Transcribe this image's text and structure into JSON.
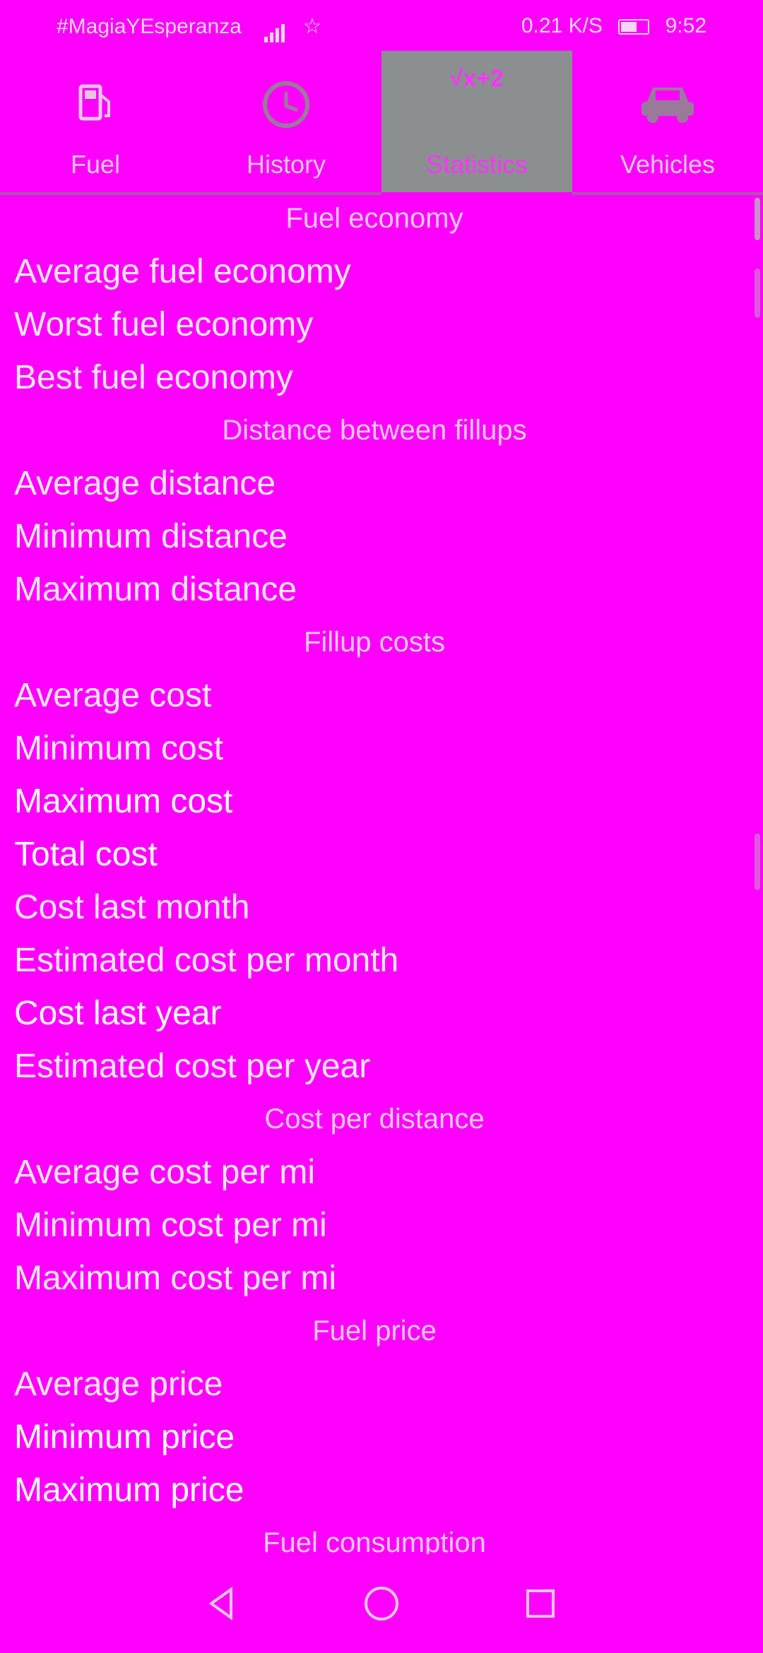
{
  "status_bar": {
    "carrier_text": "#MagiaYEsperanza",
    "right_text": "0.21 K/S",
    "time": "9:52"
  },
  "tabs": [
    {
      "label": "Fuel",
      "icon": "fuel-pump-icon",
      "active": false
    },
    {
      "label": "History",
      "icon": "clock-icon",
      "active": false
    },
    {
      "label": "Statistics",
      "icon": "formula-icon",
      "active": true
    },
    {
      "label": "Vehicles",
      "icon": "car-icon",
      "active": false
    }
  ],
  "statistics": [
    {
      "type": "header",
      "text": "Fuel economy"
    },
    {
      "type": "item",
      "text": "Average fuel economy"
    },
    {
      "type": "item",
      "text": "Worst fuel economy"
    },
    {
      "type": "item",
      "text": "Best fuel economy"
    },
    {
      "type": "header",
      "text": "Distance between fillups"
    },
    {
      "type": "item",
      "text": "Average distance"
    },
    {
      "type": "item",
      "text": "Minimum distance"
    },
    {
      "type": "item",
      "text": "Maximum distance"
    },
    {
      "type": "header",
      "text": "Fillup costs"
    },
    {
      "type": "item",
      "text": "Average cost"
    },
    {
      "type": "item",
      "text": "Minimum cost"
    },
    {
      "type": "item",
      "text": "Maximum cost",
      "bright": true
    },
    {
      "type": "item",
      "text": "Total cost",
      "bright": true
    },
    {
      "type": "item",
      "text": "Cost last month"
    },
    {
      "type": "item",
      "text": "Estimated cost per month"
    },
    {
      "type": "item",
      "text": "Cost last year",
      "bright": true
    },
    {
      "type": "item",
      "text": "Estimated cost per year"
    },
    {
      "type": "header",
      "text": "Cost per distance"
    },
    {
      "type": "item",
      "text": "Average cost per mi"
    },
    {
      "type": "item",
      "text": "Minimum cost per mi"
    },
    {
      "type": "item",
      "text": "Maximum cost per mi"
    },
    {
      "type": "header",
      "text": "Fuel price"
    },
    {
      "type": "item",
      "text": "Average price"
    },
    {
      "type": "item",
      "text": "Minimum price",
      "bright": true
    },
    {
      "type": "item",
      "text": "Maximum price",
      "bright": true
    },
    {
      "type": "header",
      "text": "Fuel consumption"
    }
  ],
  "colors": {
    "background": "#ff00ff",
    "active_tab_bg": "#8b8f90",
    "active_tab_text": "#ff33ff"
  }
}
